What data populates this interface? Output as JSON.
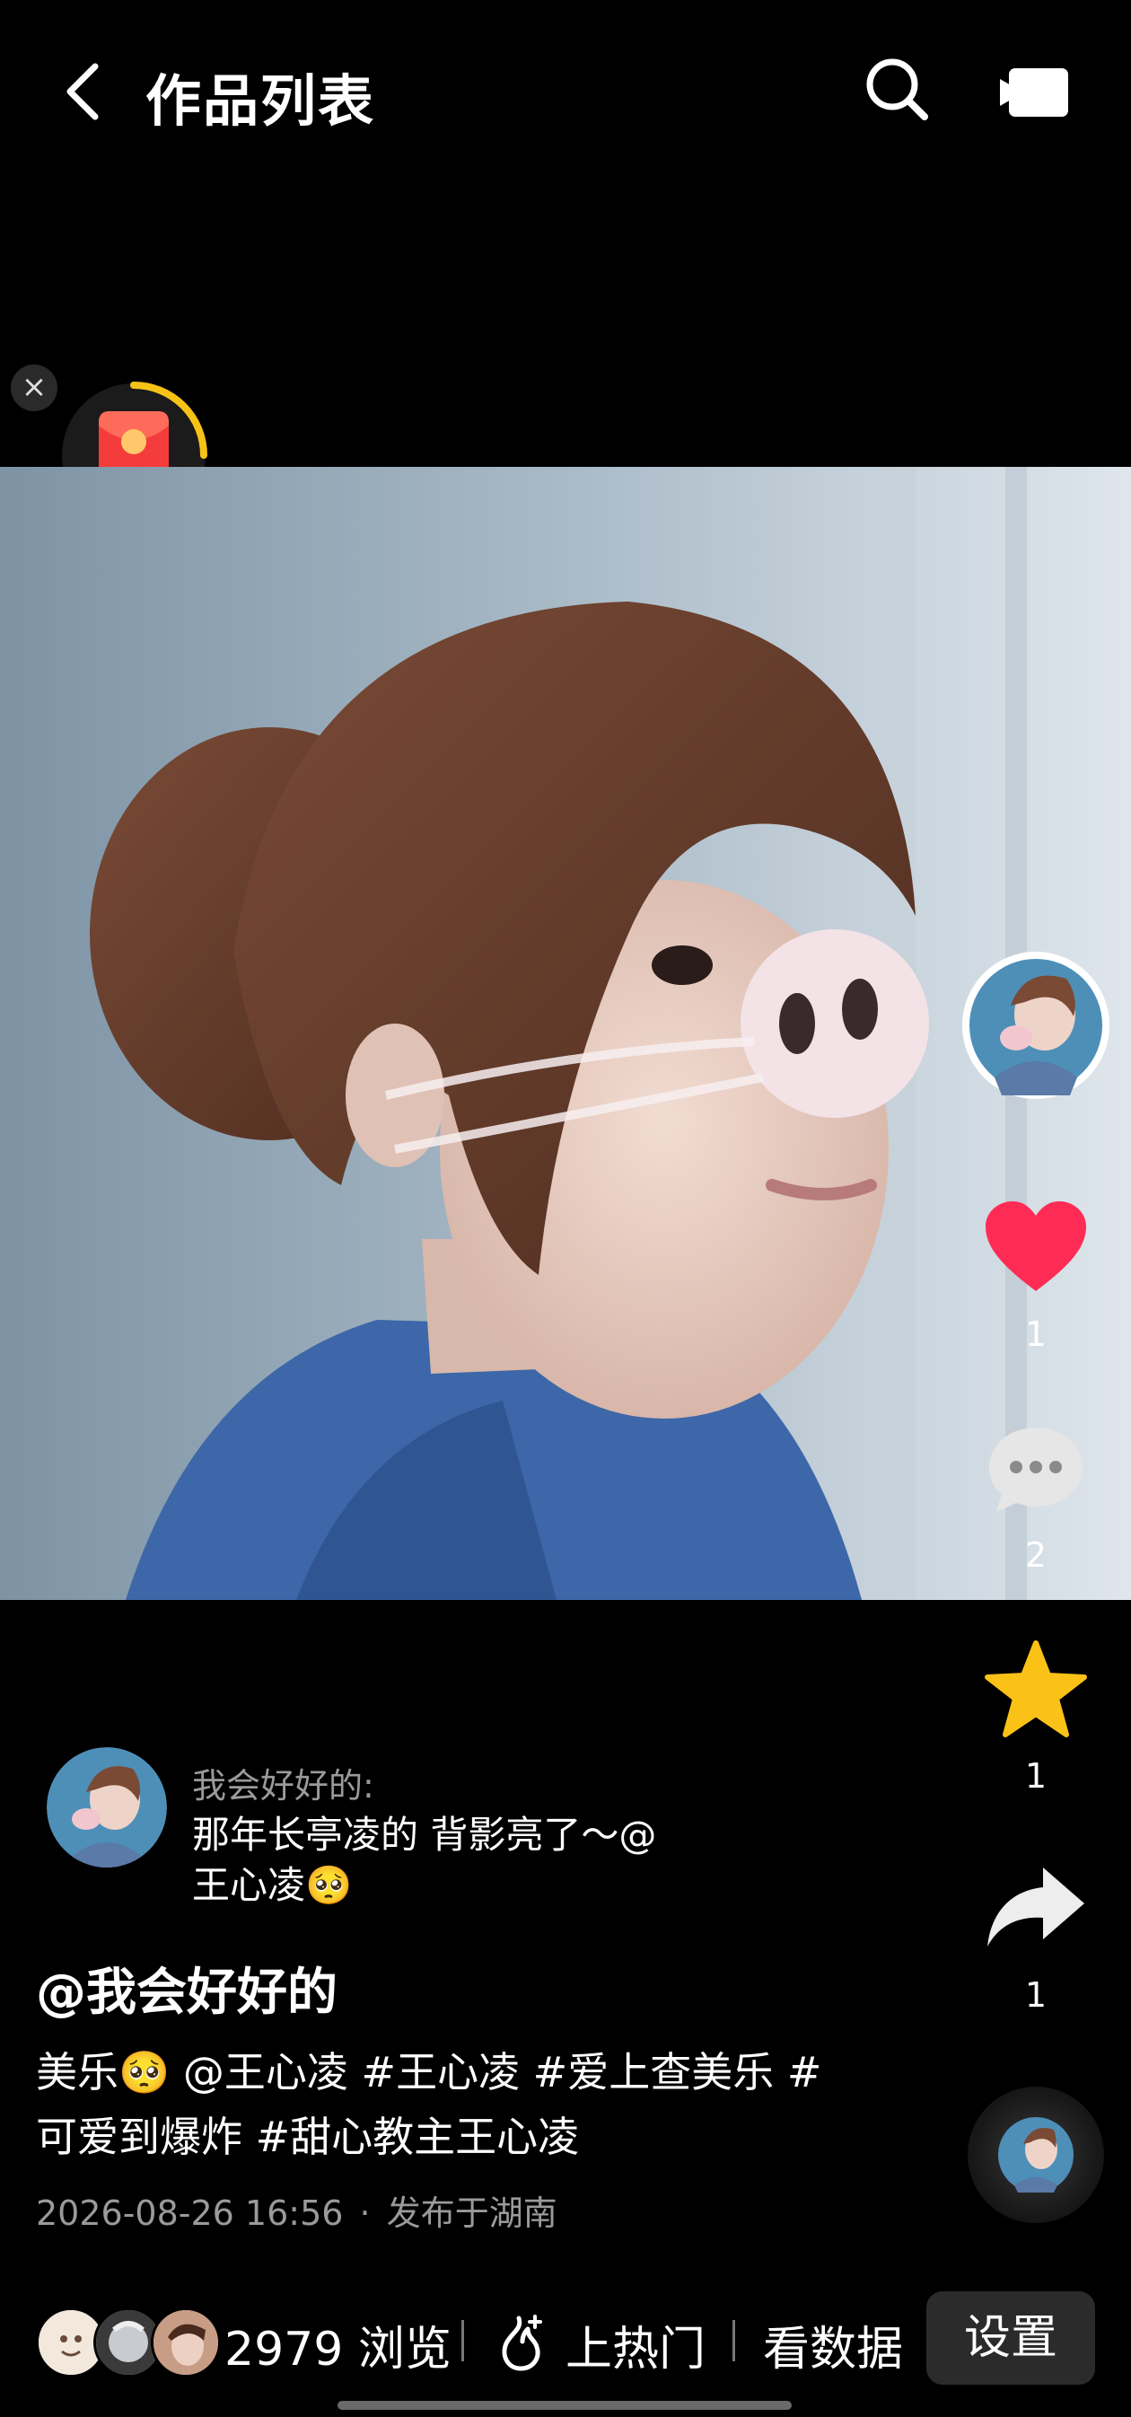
{
  "header": {
    "title": "作品列表"
  },
  "icons": [
    "back-arrow-icon",
    "search-icon",
    "tv-icon",
    "close-icon",
    "red-packet-icon",
    "heart-icon",
    "comment-icon",
    "star-icon",
    "share-icon",
    "fire-icon"
  ],
  "actions": {
    "likes": "1",
    "comments": "2",
    "favorites": "1",
    "shares": "1"
  },
  "comment": {
    "user": "我会好好的:",
    "text": "那年长亭凌的 背影亮了～@王心凌🥺"
  },
  "post": {
    "handle": "@我会好好的",
    "description": "美乐🥺 @王心凌 #王心凌 #爱上查美乐 #可爱到爆炸 #甜心教主王心凌",
    "timestamp": "2026-08-26 16:56",
    "separator": "·",
    "location": "发布于湖南"
  },
  "bottom_bar": {
    "views_count": "2979",
    "views_label": "浏览",
    "hot_label": "上热门",
    "data_label": "看数据",
    "settings_label": "设置"
  },
  "colors": {
    "accent_red": "#fe2c55",
    "star": "#fac117",
    "packet_red": "#f53c3c",
    "background": "#000000"
  }
}
